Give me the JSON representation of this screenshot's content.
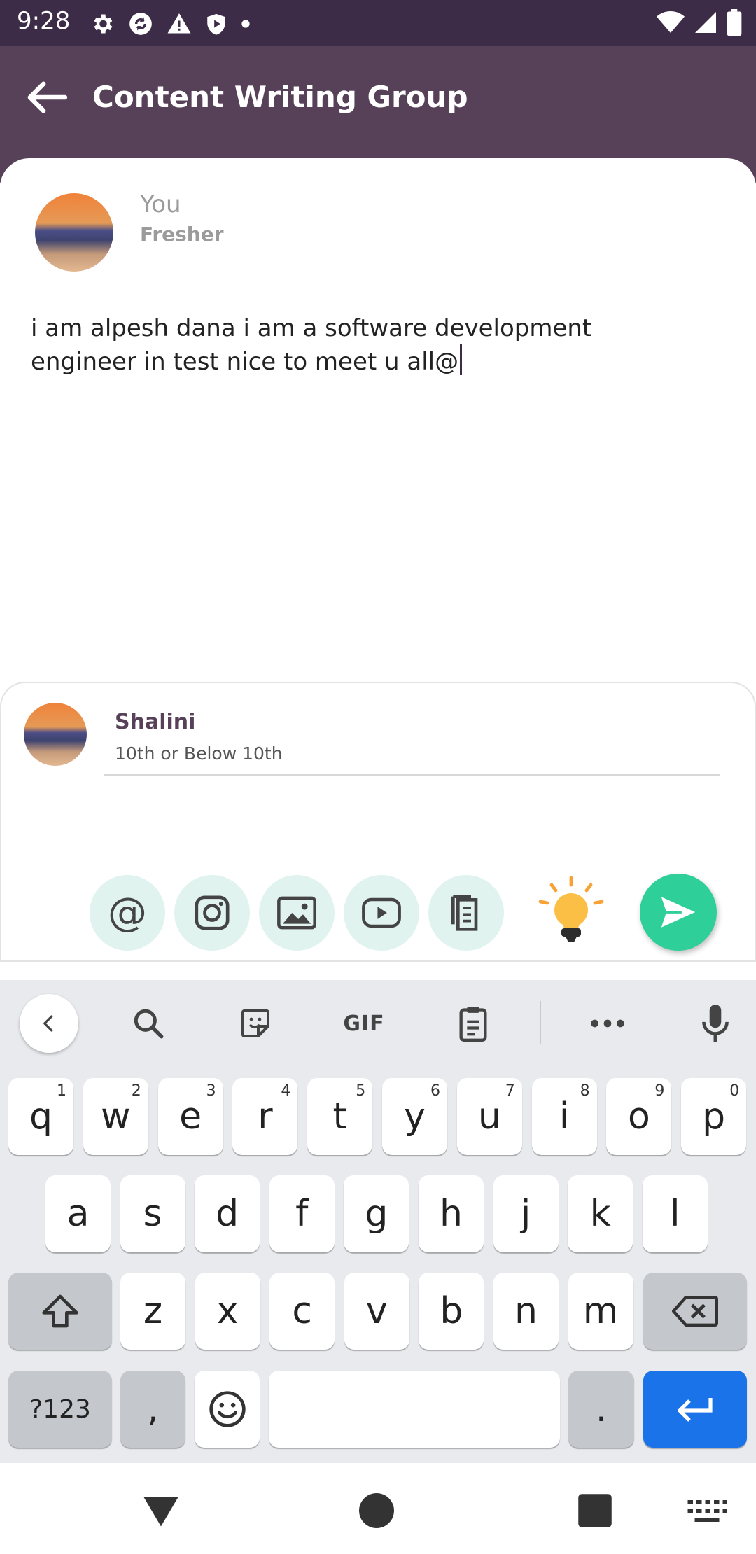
{
  "status_bar": {
    "time": "9:28",
    "left_icons": [
      "settings-icon",
      "sync-icon",
      "warning-icon",
      "shield-icon",
      "dot-icon"
    ],
    "right_icons": [
      "wifi-icon",
      "signal-icon",
      "battery-icon"
    ]
  },
  "app_bar": {
    "title": "Content Writing Group"
  },
  "composer": {
    "author_name": "You",
    "author_subtitle": "Fresher",
    "text": "i am alpesh dana i am a software development engineer in test nice to meet u all@"
  },
  "mention_suggestions": [
    {
      "name": "Shalini",
      "subtitle": "10th or Below 10th"
    }
  ],
  "toolbar": {
    "buttons": [
      "mention-button",
      "instagram-button",
      "image-button",
      "video-button",
      "document-button"
    ],
    "mention_symbol": "@",
    "accent_color": "#2ecf98",
    "chip_color": "#e0f3ef"
  },
  "keyboard": {
    "suggestion_strip": {
      "gif_label": "GIF"
    },
    "row1": [
      {
        "k": "q",
        "h": "1"
      },
      {
        "k": "w",
        "h": "2"
      },
      {
        "k": "e",
        "h": "3"
      },
      {
        "k": "r",
        "h": "4"
      },
      {
        "k": "t",
        "h": "5"
      },
      {
        "k": "y",
        "h": "6"
      },
      {
        "k": "u",
        "h": "7"
      },
      {
        "k": "i",
        "h": "8"
      },
      {
        "k": "o",
        "h": "9"
      },
      {
        "k": "p",
        "h": "0"
      }
    ],
    "row2": [
      "a",
      "s",
      "d",
      "f",
      "g",
      "h",
      "j",
      "k",
      "l"
    ],
    "row3": [
      "z",
      "x",
      "c",
      "v",
      "b",
      "n",
      "m"
    ],
    "symbols_label": "?123",
    "comma": ",",
    "period": ".",
    "enter_color": "#1a73e8"
  },
  "colors": {
    "status_bar": "#3d2c47",
    "app_bar": "#574158",
    "mention_name": "#574158"
  }
}
